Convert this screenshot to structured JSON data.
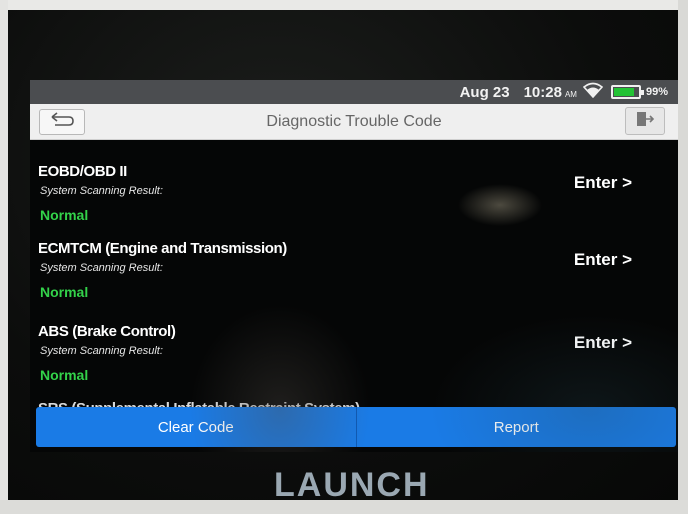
{
  "status_bar": {
    "date": "Aug 23",
    "time": "10:28",
    "ampm": "AM",
    "battery_pct": "99%",
    "battery_level": 0.99,
    "icons": [
      "wifi-icon",
      "battery-icon"
    ]
  },
  "header": {
    "title": "Diagnostic Trouble Code",
    "back_icon": "back-arrow-icon",
    "exit_icon": "exit-icon"
  },
  "systems": [
    {
      "name": "EOBD/OBD II",
      "subtitle": "System Scanning Result:",
      "result": "Normal",
      "action": "Enter >"
    },
    {
      "name": "ECMTCM (Engine and Transmission)",
      "subtitle": "System Scanning Result:",
      "result": "Normal",
      "action": "Enter >"
    },
    {
      "name": "ABS (Brake Control)",
      "subtitle": "System Scanning Result:",
      "result": "Normal",
      "action": "Enter >"
    },
    {
      "name": "SRS (Supplemental Inflatable Restraint System)"
    }
  ],
  "actions": {
    "clear_code": "Clear Code",
    "report": "Report"
  },
  "brand": {
    "logo": "LAUNCH"
  },
  "colors": {
    "accent_blue": "#1a7be6",
    "normal_green": "#33d24a",
    "status_bar": "#4b4d50",
    "title_bar": "#efefef"
  }
}
